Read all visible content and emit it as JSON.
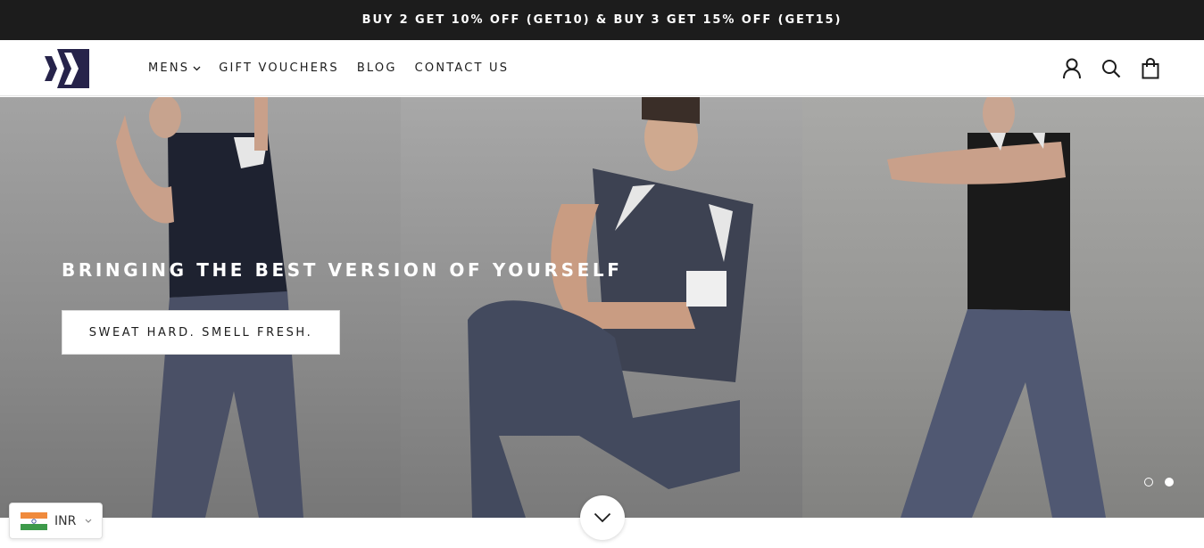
{
  "announcement": {
    "text": "BUY 2 GET 10% OFF (GET10) & BUY 3 GET 15% OFF (GET15)"
  },
  "header": {
    "logo_icon": "brand-logo-icon",
    "nav": [
      {
        "label": "MENS",
        "has_dropdown": true
      },
      {
        "label": "GIFT VOUCHERS",
        "has_dropdown": false
      },
      {
        "label": "BLOG",
        "has_dropdown": false
      },
      {
        "label": "CONTACT US",
        "has_dropdown": false
      }
    ],
    "icons": [
      "account-icon",
      "search-icon",
      "cart-icon"
    ]
  },
  "hero": {
    "title": "BRINGING THE BEST VERSION OF YOURSELF",
    "button_label": "SWEAT HARD. SMELL FRESH.",
    "slides_total": 2,
    "active_slide": 2
  },
  "currency": {
    "code": "INR",
    "flag": "india-flag-icon"
  },
  "colors": {
    "announcement_bg": "#1c1c1c",
    "brand_navy": "#26234a",
    "text_dark": "#1c1c1c"
  }
}
